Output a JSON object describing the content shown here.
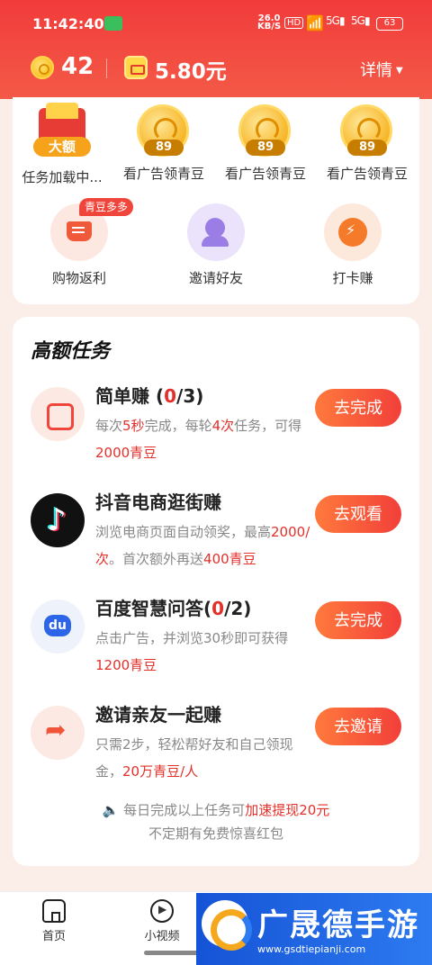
{
  "status_bar": {
    "time": "11:42:40",
    "speed_value": "26.0",
    "speed_unit": "KB/S",
    "hd": "HD",
    "net1": "5G",
    "net2": "5G",
    "battery": "63"
  },
  "header": {
    "coins": "42",
    "cash": "5.80元",
    "details_label": "详情"
  },
  "rewards": [
    {
      "label": "任务加载中...",
      "tag": "大额",
      "icon": "red-envelope-icon"
    },
    {
      "label": "看广告领青豆",
      "num": "89",
      "icon": "coin-icon"
    },
    {
      "label": "看广告领青豆",
      "num": "89",
      "icon": "coin-icon"
    },
    {
      "label": "看广告领青豆",
      "num": "89",
      "icon": "coin-icon"
    }
  ],
  "functions": [
    {
      "label": "购物返利",
      "badge": "青豆多多",
      "icon": "shopping-cart-icon"
    },
    {
      "label": "邀请好友",
      "icon": "invite-user-icon"
    },
    {
      "label": "打卡赚",
      "icon": "alarm-clock-icon"
    }
  ],
  "tasks_section": {
    "title": "高额任务",
    "tasks": [
      {
        "name_prefix": "简单赚 (",
        "name_highlight": "0",
        "name_suffix": "/3)",
        "desc_parts": [
          "每次",
          "5秒",
          "完成，每轮",
          "4次",
          "任务，可得",
          "2000青豆"
        ],
        "button": "去完成",
        "icon": "red-envelope-icon"
      },
      {
        "name_prefix": "抖音电商逛街赚",
        "name_highlight": "",
        "name_suffix": "",
        "desc_parts": [
          "浏览电商页面自动领奖，最高",
          "2000/次",
          "。首次额外再送",
          "400青豆"
        ],
        "button": "去观看",
        "icon": "douyin-icon"
      },
      {
        "name_prefix": "百度智慧问答(",
        "name_highlight": "0",
        "name_suffix": "/2)",
        "desc_parts": [
          "点击广告，并浏览30秒即可获得",
          "1200青豆"
        ],
        "button": "去完成",
        "icon": "baidu-icon"
      },
      {
        "name_prefix": "邀请亲友一起赚",
        "name_highlight": "",
        "name_suffix": "",
        "desc_parts": [
          "只需2步，轻松帮好友和自己领现金，",
          "20万青豆/人"
        ],
        "button": "去邀请",
        "icon": "share-arrow-icon"
      }
    ],
    "notice_line1_prefix": "每日完成以上任务可",
    "notice_line1_highlight": "加速提现20元",
    "notice_line2": "不定期有免费惊喜红包"
  },
  "bottom_nav": {
    "items": [
      {
        "label": "首页",
        "icon": "home-icon"
      },
      {
        "label": "小视频",
        "icon": "video-play-icon"
      }
    ]
  },
  "watermark": {
    "title": "广晟德手游",
    "url": "www.gsdtiepianji.com"
  }
}
